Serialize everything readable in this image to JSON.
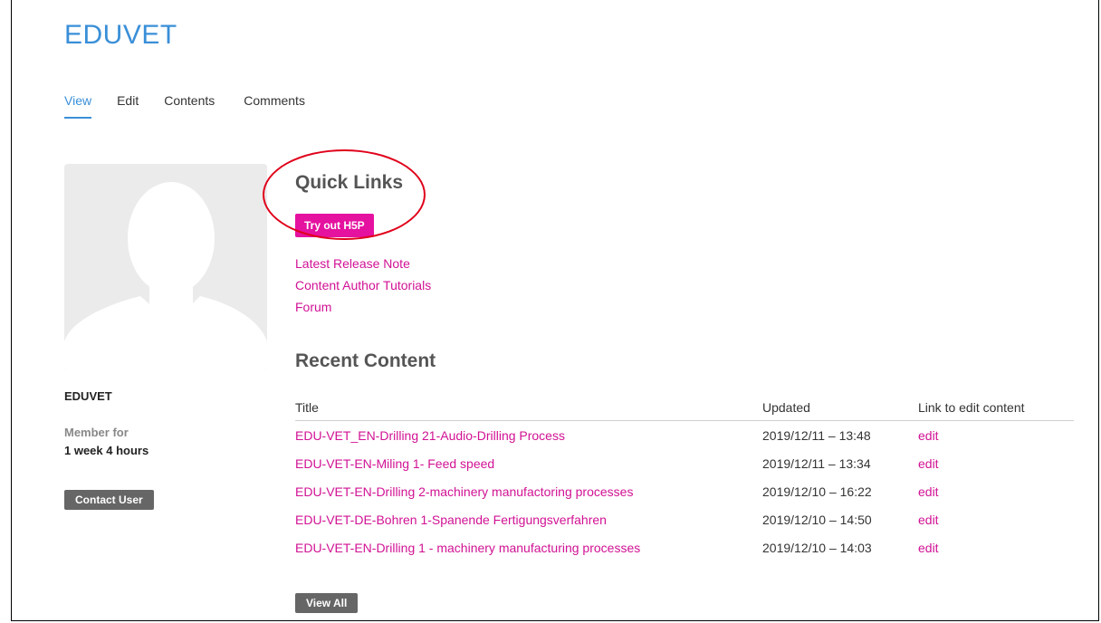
{
  "site": {
    "title": "EDUVET"
  },
  "tabs": [
    {
      "label": "View",
      "active": true
    },
    {
      "label": "Edit",
      "active": false
    },
    {
      "label": "Contents",
      "active": false
    },
    {
      "label": "Comments",
      "active": false
    }
  ],
  "profile": {
    "username": "EDUVET",
    "member_for_label": "Member for",
    "member_for_value": "1 week 4 hours",
    "contact_button": "Contact User"
  },
  "quick_links": {
    "title": "Quick Links",
    "h5p_button": "Try out H5P",
    "links": [
      "Latest Release Note",
      "Content Author Tutorials",
      "Forum"
    ]
  },
  "recent_content": {
    "title": "Recent Content",
    "columns": [
      "Title",
      "Updated",
      "Link to edit content"
    ],
    "rows": [
      {
        "title": "EDU-VET_EN-Drilling 21-Audio-Drilling Process",
        "updated": "2019/12/11 – 13:48",
        "action": "edit"
      },
      {
        "title": "EDU-VET-EN-Miling 1- Feed speed",
        "updated": "2019/12/11 – 13:34",
        "action": "edit"
      },
      {
        "title": "EDU-VET-EN-Drilling 2-machinery manufactoring processes",
        "updated": "2019/12/10 – 16:22",
        "action": "edit"
      },
      {
        "title": "EDU-VET-DE-Bohren 1-Spanende Fertigungsverfahren",
        "updated": "2019/12/10 – 14:50",
        "action": "edit"
      },
      {
        "title": "EDU-VET-EN-Drilling 1 - machinery manufacturing processes",
        "updated": "2019/12/10 – 14:03",
        "action": "edit"
      }
    ],
    "view_all_button": "View All"
  },
  "colors": {
    "title_blue": "#3a8fd8",
    "link_magenta": "#d11294",
    "h5p_button": "#e5119f",
    "annotation_circle": "#e0001a",
    "dark_button": "#666666"
  }
}
